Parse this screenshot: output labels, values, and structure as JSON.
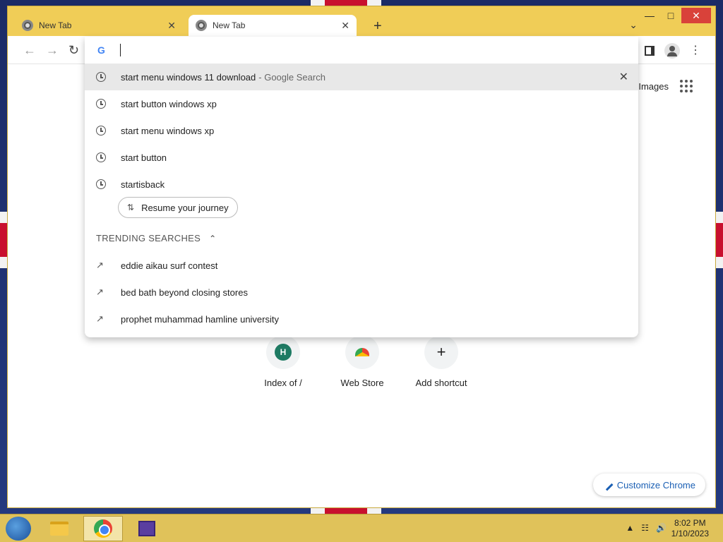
{
  "tabs": [
    {
      "title": "New Tab",
      "active": false
    },
    {
      "title": "New Tab",
      "active": true
    }
  ],
  "toolbar": {
    "url": ""
  },
  "page": {
    "top_link": "Images",
    "shortcuts": [
      {
        "label": "Index of /",
        "icon": "H"
      },
      {
        "label": "Web Store",
        "icon": "webstore-icon"
      },
      {
        "label": "Add shortcut",
        "icon": "+"
      }
    ],
    "customize_label": "Customize Chrome"
  },
  "omnibox": {
    "history": [
      {
        "text": "start menu windows 11 download",
        "suffix": "- Google Search"
      },
      {
        "text": "start button windows xp"
      },
      {
        "text": "start menu windows xp"
      },
      {
        "text": "start button"
      },
      {
        "text": "startisback"
      }
    ],
    "journey_label": "Resume your journey",
    "trending_header": "TRENDING SEARCHES",
    "trending": [
      {
        "text": "eddie aikau surf contest"
      },
      {
        "text": "bed bath beyond closing stores"
      },
      {
        "text": "prophet muhammad hamline university"
      }
    ]
  },
  "taskbar": {
    "time": "8:02 PM",
    "date": "1/10/2023"
  },
  "colors": {
    "window_frame": "#f0cd57",
    "taskbar": "#e0c25a",
    "link_blue": "#1a5fb4",
    "close_red": "#d9423a"
  }
}
